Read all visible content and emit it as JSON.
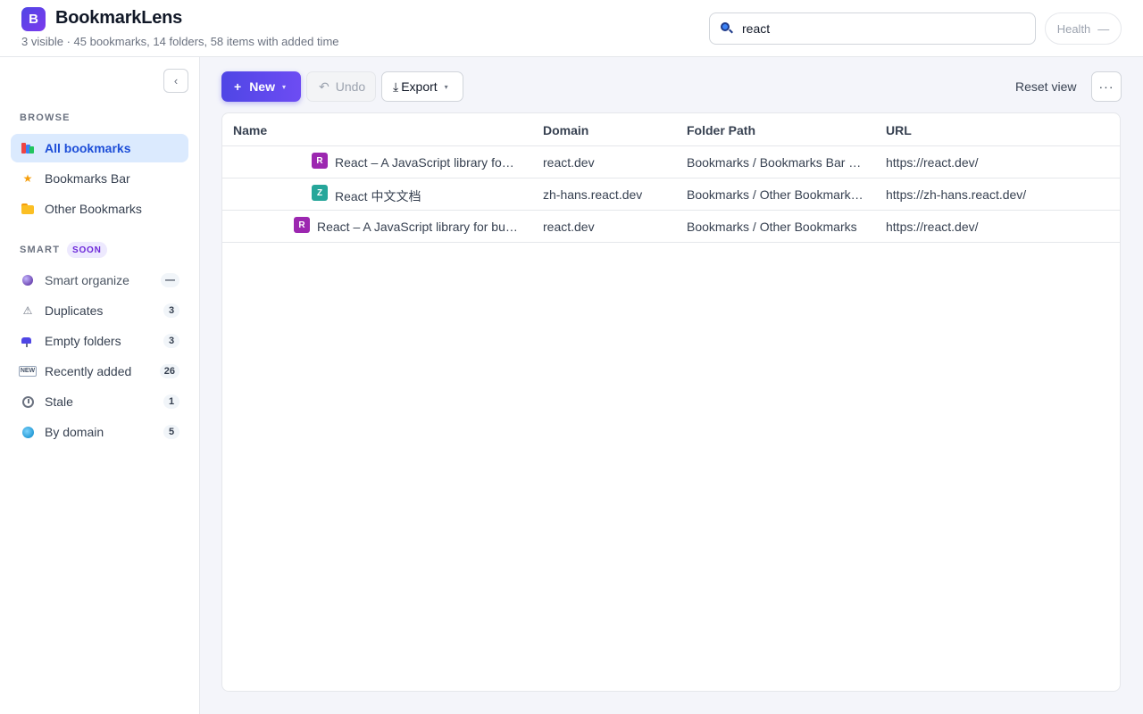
{
  "app": {
    "logo_letter": "B",
    "title": "BookmarkLens",
    "subtitle": "3 visible · 45 bookmarks, 14 folders, 58 items with added time"
  },
  "search": {
    "value": "react",
    "icon": "search-icon"
  },
  "health": {
    "label": "Health",
    "value": "—"
  },
  "sidebar": {
    "collapse_label": "‹",
    "browse_label": "BROWSE",
    "browse_items": [
      {
        "label": "All bookmarks",
        "icon": "books-icon",
        "active": true
      },
      {
        "label": "Bookmarks Bar",
        "icon": "star-icon"
      },
      {
        "label": "Other Bookmarks",
        "icon": "folder-icon"
      }
    ],
    "smart_label": "SMART",
    "soon_badge": "SOON",
    "smart_items": [
      {
        "label": "Smart organize",
        "icon": "crystal-ball-icon",
        "count": "—"
      },
      {
        "label": "Duplicates",
        "icon": "warning-icon",
        "count": "3"
      },
      {
        "label": "Empty folders",
        "icon": "mailbox-icon",
        "count": "3"
      },
      {
        "label": "Recently added",
        "icon": "new-icon",
        "count": "26"
      },
      {
        "label": "Stale",
        "icon": "clock-icon",
        "count": "1"
      },
      {
        "label": "By domain",
        "icon": "globe-icon",
        "count": "5"
      }
    ]
  },
  "toolbar": {
    "new_label": "New",
    "new_prefix": "+",
    "undo_label": "Undo",
    "undo_prefix": "↶",
    "export_label": "Export",
    "export_prefix": "⤓",
    "caret": "▾",
    "reset_view_label": "Reset view",
    "more_label": "···"
  },
  "table": {
    "columns": [
      "Name",
      "Domain",
      "Folder Path",
      "URL"
    ],
    "rows": [
      {
        "favicon_letter": "R",
        "favicon_color": "#9c27b0",
        "name": "React – A JavaScript library for building user interfaces",
        "domain": "react.dev",
        "folder_path": "Bookmarks / Bookmarks Bar / React",
        "url": "https://react.dev/"
      },
      {
        "favicon_letter": "Z",
        "favicon_color": "#26a69a",
        "name": "React 中文文档",
        "domain": "zh-hans.react.dev",
        "folder_path": "Bookmarks / Other Bookmarks / React",
        "url": "https://zh-hans.react.dev/"
      },
      {
        "favicon_letter": "R",
        "favicon_color": "#9c27b0",
        "name": "React – A JavaScript library for building user interfaces",
        "domain": "react.dev",
        "folder_path": "Bookmarks / Other Bookmarks",
        "url": "https://react.dev/"
      }
    ]
  },
  "colors": {
    "accent": "#4f46e5",
    "active_nav_bg": "#dbeafe",
    "active_nav_text": "#1d4ed8"
  }
}
